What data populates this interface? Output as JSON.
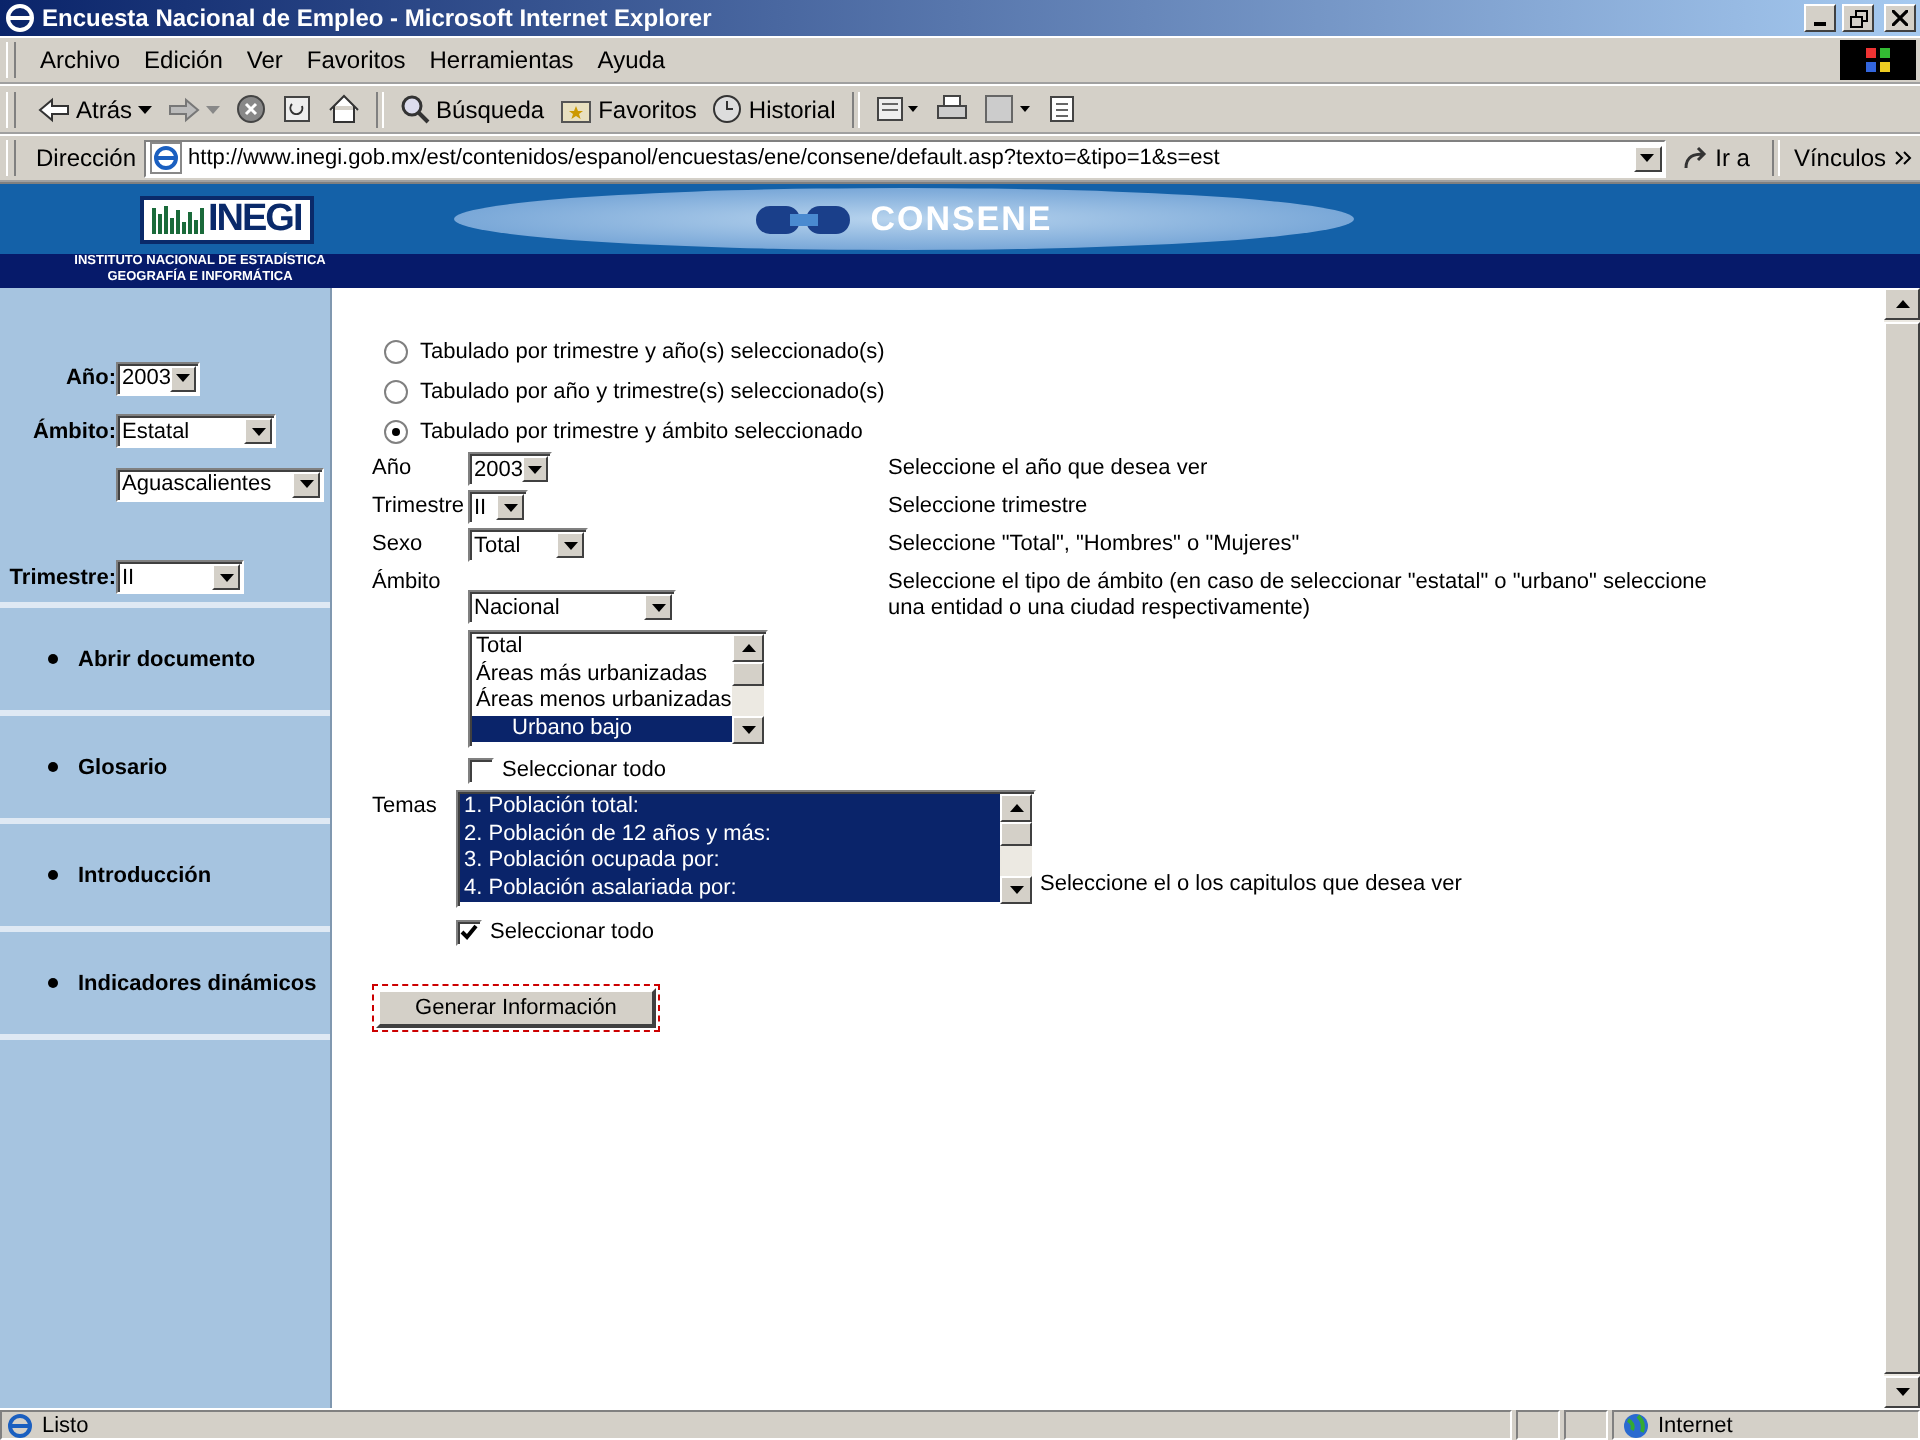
{
  "window": {
    "title": "Encuesta Nacional de Empleo - Microsoft Internet Explorer"
  },
  "menu": [
    "Archivo",
    "Edición",
    "Ver",
    "Favoritos",
    "Herramientas",
    "Ayuda"
  ],
  "toolbar": [
    {
      "kind": "back",
      "label": "Atrás"
    },
    {
      "kind": "forward"
    },
    {
      "kind": "stop"
    },
    {
      "kind": "refresh"
    },
    {
      "kind": "home"
    },
    {
      "kind": "sep"
    },
    {
      "kind": "search",
      "label": "Búsqueda"
    },
    {
      "kind": "favorites",
      "label": "Favoritos"
    },
    {
      "kind": "history",
      "label": "Historial"
    },
    {
      "kind": "sep"
    },
    {
      "kind": "mail"
    },
    {
      "kind": "print"
    },
    {
      "kind": "edit"
    },
    {
      "kind": "discuss"
    }
  ],
  "address": {
    "label": "Dirección",
    "url": "http://www.inegi.gob.mx/est/contenidos/espanol/encuestas/ene/consene/default.asp?texto=&tipo=1&s=est",
    "go": "Ir a",
    "links": "Vínculos"
  },
  "header": {
    "logo": "INEGI",
    "institute": [
      "INSTITUTO NACIONAL DE ESTADÍSTICA",
      "GEOGRAFÍA E INFORMÁTICA"
    ],
    "product": "CONSENE"
  },
  "sidebar": {
    "filters": [
      {
        "label": "Año:",
        "value": "2003"
      },
      {
        "label": "Ámbito:",
        "value": "Estatal"
      },
      {
        "value": "Aguascalientes"
      },
      {
        "label": "Trimestre:",
        "value": "II"
      }
    ],
    "nav": [
      "Abrir documento",
      "Glosario",
      "Introducción",
      "Indicadores dinámicos"
    ]
  },
  "form": {
    "options": [
      {
        "label": "Tabulado por trimestre y año(s) seleccionado(s)",
        "selected": false
      },
      {
        "label": "Tabulado por año y trimestre(s) seleccionado(s)",
        "selected": false
      },
      {
        "label": "Tabulado por trimestre y ámbito seleccionado",
        "selected": true
      }
    ],
    "year": {
      "label": "Año",
      "value": "2003",
      "hint": "Seleccione el año que desea ver"
    },
    "quarter": {
      "label": "Trimestre",
      "value": "II",
      "hint": "Seleccione trimestre"
    },
    "sex": {
      "label": "Sexo",
      "value": "Total",
      "hint": "Seleccione \"Total\", \"Hombres\" o \"Mujeres\""
    },
    "scope": {
      "label": "Ámbito",
      "value": "Nacional",
      "hint": "Seleccione el tipo de ámbito (en caso de seleccionar \"estatal\" o \"urbano\" seleccione una entidad o una ciudad respectivamente)",
      "items": [
        {
          "label": "Total",
          "selected": false
        },
        {
          "label": "Áreas más urbanizadas",
          "selected": false
        },
        {
          "label": "Áreas menos urbanizadas",
          "selected": false
        },
        {
          "label": "Urbano bajo",
          "selected": true
        }
      ],
      "select_all": {
        "label": "Seleccionar todo",
        "checked": false
      }
    },
    "topics": {
      "label": "Temas",
      "hint": "Seleccione el o los capitulos que desea ver",
      "items": [
        {
          "label": "1. Población total:",
          "selected": true
        },
        {
          "label": "2. Población de 12 años y más:",
          "selected": true
        },
        {
          "label": "3. Población ocupada por:",
          "selected": true
        },
        {
          "label": "4. Población asalariada por:",
          "selected": true
        }
      ],
      "select_all": {
        "label": "Seleccionar todo",
        "checked": true
      }
    },
    "submit": "Generar Información"
  },
  "status_bar": {
    "text": "Listo",
    "zone": "Internet"
  }
}
